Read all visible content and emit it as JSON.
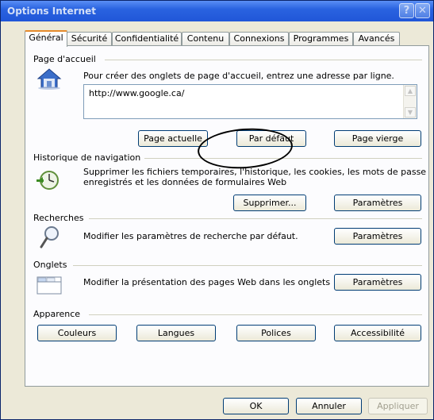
{
  "window": {
    "title": "Options Internet",
    "help_icon": "?",
    "close_icon": "✕"
  },
  "tabs": [
    {
      "label": "Général",
      "active": true
    },
    {
      "label": "Sécurité"
    },
    {
      "label": "Confidentialité"
    },
    {
      "label": "Contenu"
    },
    {
      "label": "Connexions"
    },
    {
      "label": "Programmes"
    },
    {
      "label": "Avancés"
    }
  ],
  "homepage": {
    "title": "Page d'accueil",
    "description": "Pour créer des onglets de page d'accueil, entrez une adresse par ligne.",
    "url_value": "http://www.google.ca/",
    "buttons": {
      "current": "Page actuelle",
      "default": "Par défaut",
      "blank": "Page vierge"
    }
  },
  "history": {
    "title": "Historique de navigation",
    "description_line1": "Supprimer les fichiers temporaires, l'historique, les cookies, les mots de passe",
    "description_line2": "enregistrés et les données de formulaires Web",
    "buttons": {
      "delete": "Supprimer...",
      "settings": "Paramètres"
    }
  },
  "search": {
    "title": "Recherches",
    "description": "Modifier les paramètres de recherche par défaut.",
    "settings_label": "Paramètres"
  },
  "tabs_group": {
    "title": "Onglets",
    "description": "Modifier la présentation des pages Web dans les onglets",
    "settings_label": "Paramètres"
  },
  "appearance": {
    "title": "Apparence",
    "buttons": {
      "colors": "Couleurs",
      "languages": "Langues",
      "fonts": "Polices",
      "accessibility": "Accessibilité"
    }
  },
  "footer": {
    "ok": "OK",
    "cancel": "Annuler",
    "apply": "Appliquer"
  }
}
